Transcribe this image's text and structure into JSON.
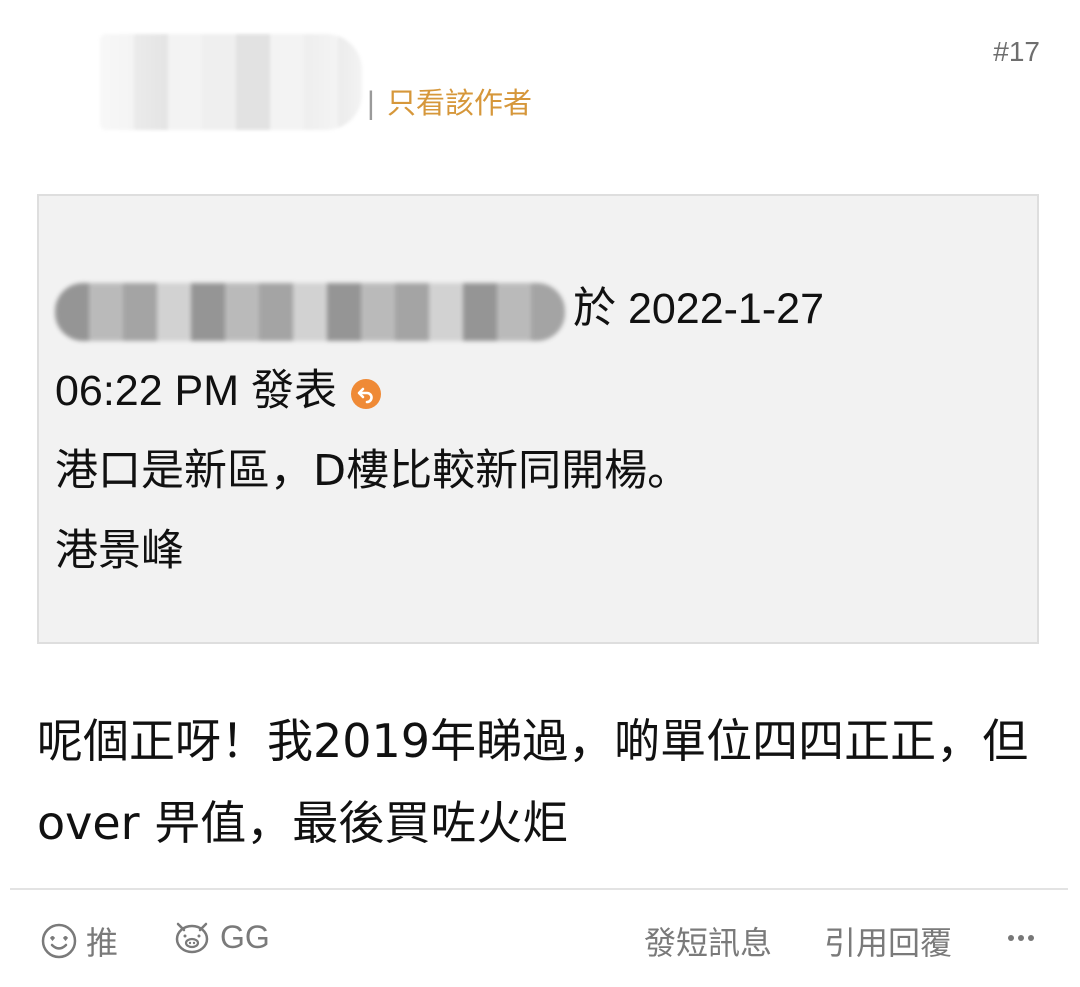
{
  "post": {
    "floor": "#17",
    "author_filter_separator": "|",
    "author_filter_label": "只看該作者"
  },
  "quote": {
    "posted_at_prefix": "於 2022-1-27",
    "posted_at_time": "06:22 PM 發表",
    "line1": "港口是新區，D樓比較新同開楊。",
    "line2": "港景峰"
  },
  "reply": {
    "text": "呢個正呀！我2019年睇過，啲單位四四正正，但 over 畀值，最後買咗火炬"
  },
  "actions": {
    "push_label": "推",
    "gg_label": "GG",
    "pm_label": "發短訊息",
    "quote_reply_label": "引用回覆"
  },
  "colors": {
    "accent": "#d6973a",
    "reply_icon": "#ef8a36",
    "quote_bg": "#f2f2f2"
  },
  "icons": {
    "push": "smiley-heart-eyes-icon",
    "gg": "pig-face-icon",
    "quote_jump": "reply-arrow-icon",
    "more": "more-vertical-icon"
  }
}
